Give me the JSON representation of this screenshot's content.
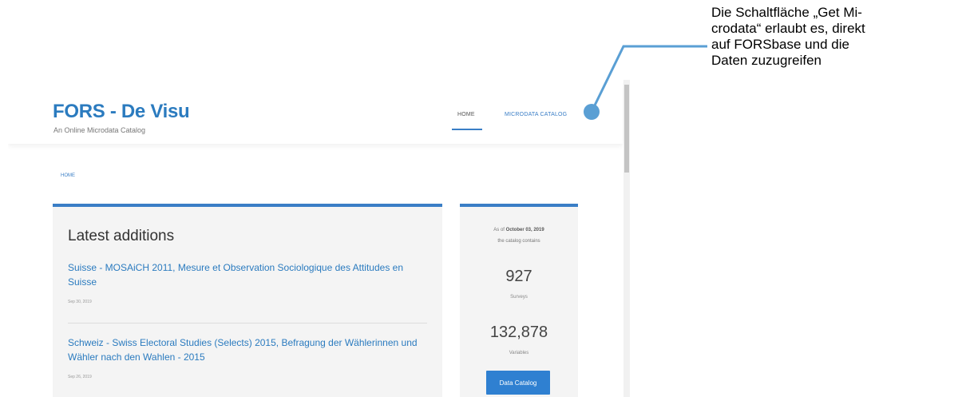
{
  "site": {
    "title": "FORS - De Visu",
    "subtitle": "An Online Microdata Catalog"
  },
  "nav": {
    "home": "HOME",
    "microdata_catalog": "MICRODATA CATALOG"
  },
  "breadcrumb": "HOME",
  "latest": {
    "heading": "Latest additions",
    "items": [
      {
        "title": "Suisse - MOSAiCH 2011, Mesure et Observation Sociologique des Attitudes en Suisse",
        "date": "Sep 30, 2019"
      },
      {
        "title": "Schweiz - Swiss Electoral Studies (Selects) 2015, Befragung der Wählerinnen und Wähler nach den Wahlen - 2015",
        "date": "Sep 26, 2019"
      }
    ]
  },
  "stats": {
    "as_of_prefix": "As of",
    "as_of_date": "October 03, 2019",
    "catalog_contains": "the catalog contains",
    "surveys_count": "927",
    "surveys_label": "Surveys",
    "variables_count": "132,878",
    "variables_label": "Variables",
    "button": "Data Catalog"
  },
  "callout": {
    "text": "Die Schaltfläche „Get Mi-\ncrodata“ erlaubt es, direkt\nauf FORSbase und die\nDaten zuzugreifen",
    "color": "#5a9fd4"
  },
  "colors": {
    "accent": "#3a7ec6",
    "link": "#2b7bbf",
    "button": "#2f80d1"
  }
}
